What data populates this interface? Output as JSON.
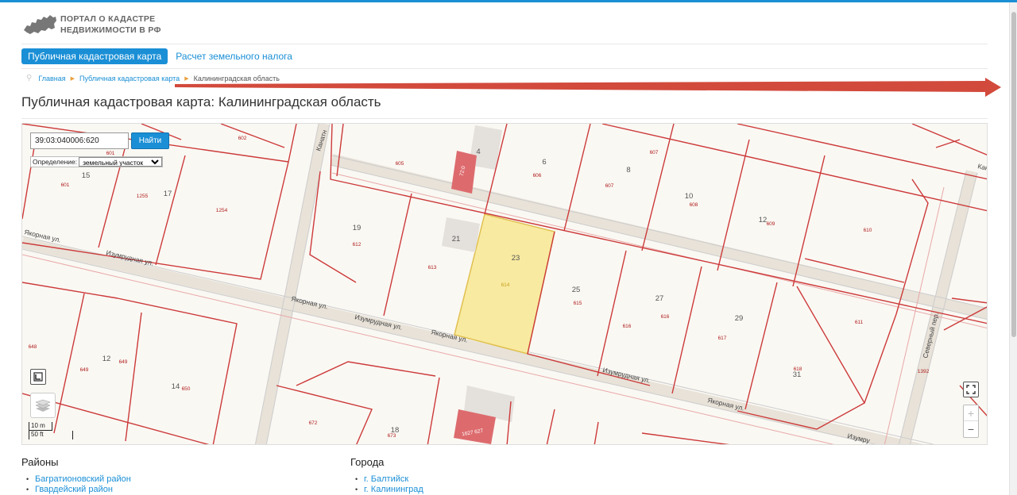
{
  "header": {
    "logo_line1": "ПОРТАЛ О КАДАСТРЕ",
    "logo_line2": "НЕДВИЖИМОСТИ В РФ"
  },
  "nav": {
    "active": "Публичная кадастровая карта",
    "link": "Расчет земельного налога"
  },
  "breadcrumbs": [
    "Главная",
    "Публичная кадастровая карта",
    "Калининградская область"
  ],
  "page_title": "Публичная кадастровая карта: Калининградская область",
  "map": {
    "search_value": "39:03:040006:620",
    "search_button": "Найти",
    "definition_label": "Определение:",
    "definition_selected": "земельный участок",
    "scale_m": "10 m",
    "scale_ft": "50 ft",
    "zoom_in": "+",
    "zoom_out": "−",
    "streets": {
      "izumrudnaya_1": "Изумрудная ул.",
      "izumrudnaya_2": "Изумрудная ул.",
      "izumrudnaya_3": "Изумрудная ул.",
      "izumrudnaya_4": "Изумру",
      "yakornaya_1": "Якорная ул.",
      "yakornaya_2": "Якорная ул.",
      "yakornaya_3": "Якорная ул.",
      "kanatnaya": "Канатн",
      "kanat_right": "Кан",
      "severny": "Северный пер.",
      "yakornaya_left": "Якорная ул."
    },
    "house_numbers": {
      "h15": "15",
      "h17": "17",
      "h19": "19",
      "h21": "21",
      "h23": "23",
      "h25": "25",
      "h27": "27",
      "h29": "29",
      "h31": "31",
      "h4": "4",
      "h6": "6",
      "h8": "8",
      "h10": "10",
      "h12top": "12",
      "h12": "12",
      "h14": "14",
      "h18": "18"
    },
    "parcel_numbers": {
      "p601": "601",
      "p601b": "601",
      "p602": "602",
      "p605": "605",
      "p606": "606",
      "p607": "607",
      "p607b": "607",
      "p608": "608",
      "p609": "609",
      "p610": "610",
      "p611": "611",
      "p612": "612",
      "p613": "613",
      "p614": "614",
      "p615": "615",
      "p616": "616",
      "p616b": "616",
      "p617": "617",
      "p618": "618",
      "p648": "648",
      "p649": "649",
      "p649b": "649",
      "p650": "650",
      "p672": "672",
      "p673": "673",
      "p1254": "1254",
      "p1255": "1255",
      "p1392": "1392",
      "b1": "72:0",
      "b2": "1627 627"
    }
  },
  "lists": {
    "districts_title": "Районы",
    "districts": [
      "Багратионовский район",
      "Гвардейский район"
    ],
    "cities_title": "Города",
    "cities": [
      "г. Балтийск",
      "г. Калининград"
    ]
  }
}
